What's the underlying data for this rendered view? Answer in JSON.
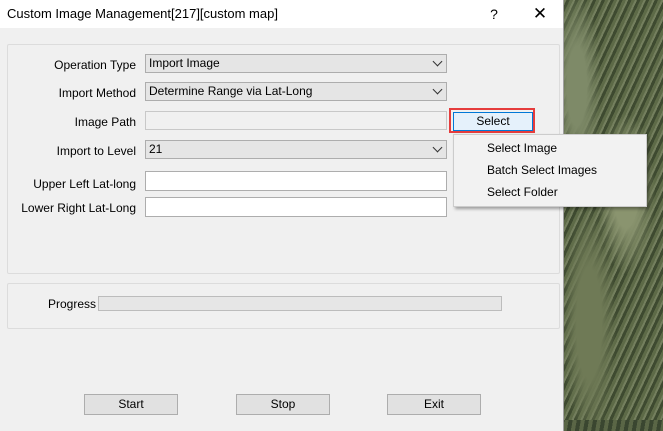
{
  "window": {
    "title": "Custom Image Management[217][custom map]",
    "help_label": "?",
    "close_label": "✕"
  },
  "form": {
    "operation_type_label": "Operation Type",
    "operation_type_value": "Import Image",
    "import_method_label": "Import Method",
    "import_method_value": "Determine Range via Lat-Long",
    "image_path_label": "Image Path",
    "image_path_value": "",
    "select_label": "Select",
    "import_level_label": "Import to Level",
    "import_level_value": "21",
    "upper_left_label": "Upper Left Lat-long",
    "upper_left_value": "",
    "lower_right_label": "Lower Right Lat-Long",
    "lower_right_value": ""
  },
  "select_menu": {
    "items": [
      "Select Image",
      "Batch Select Images",
      "Select Folder"
    ]
  },
  "progress": {
    "label": "Progress",
    "value": 0
  },
  "buttons": {
    "start": "Start",
    "stop": "Stop",
    "exit": "Exit"
  }
}
